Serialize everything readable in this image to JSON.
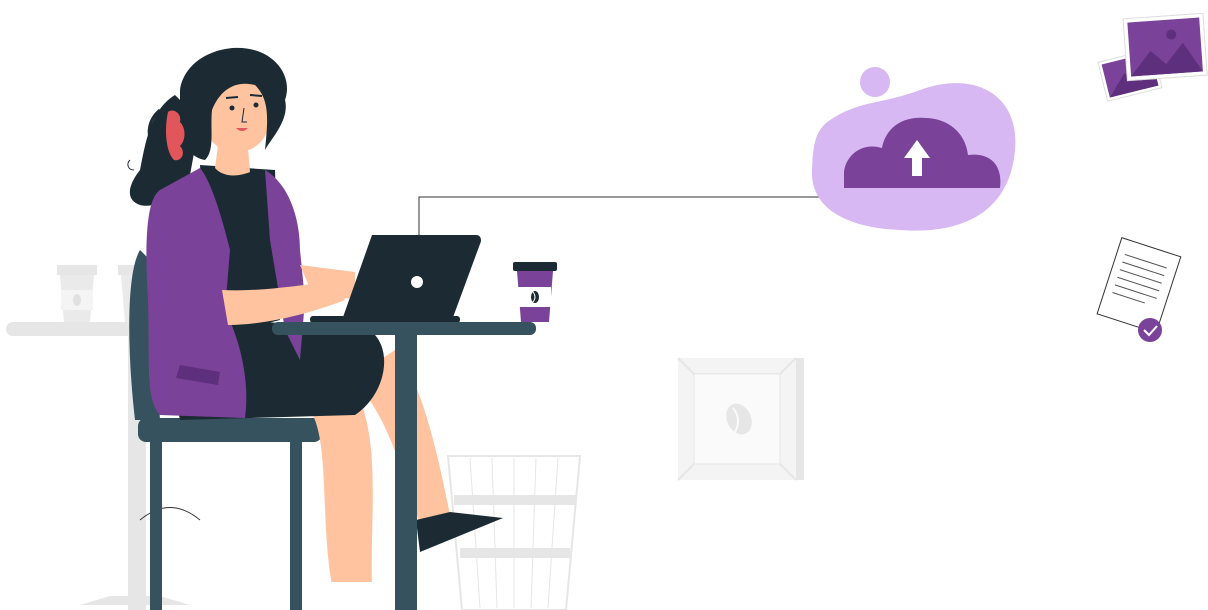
{
  "scene": {
    "cloud_upload": {
      "icon": "cloud-upload-icon"
    },
    "photos": {
      "icon": "image-icon"
    },
    "document": {
      "icon": "document-check-icon"
    },
    "laptop": {
      "icon": "laptop-icon"
    },
    "cup": {
      "icon": "coffee-cup-icon"
    },
    "box": {
      "icon": "coffee-bean-icon"
    }
  },
  "colors": {
    "purple": "#7a4399",
    "purple_light": "#d7b8f3",
    "purple_mid": "#c9a7ee",
    "dark": "#1c2b33",
    "chair": "#35525e",
    "skin": "#ffc3a0",
    "hair_tie": "#e0565a",
    "grey": "#e6e6e6"
  }
}
